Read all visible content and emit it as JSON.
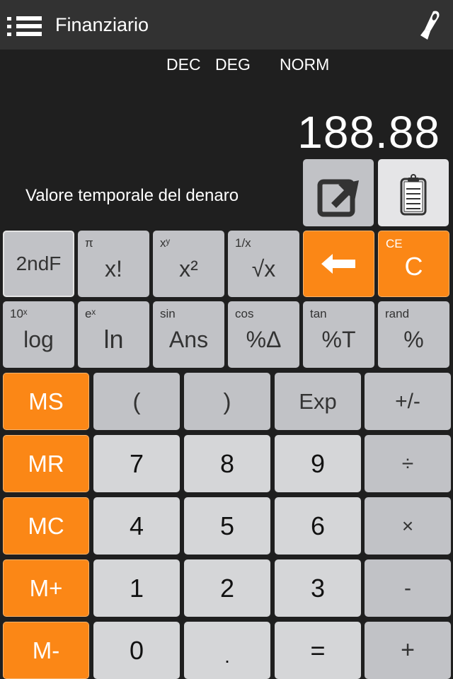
{
  "header": {
    "title": "Finanziario",
    "menu_icon": "menu-list-icon",
    "tape_icon": "paper-tape-icon"
  },
  "status": {
    "base": "DEC",
    "angle": "DEG",
    "notation": "NORM"
  },
  "display": {
    "value": "188.88",
    "mode_label": "Valore temporale del denaro"
  },
  "actions": {
    "export_icon": "share-export-icon",
    "clipboard_icon": "clipboard-icon"
  },
  "colors": {
    "accent": "#fb8716",
    "function_key": "#c1c2c6",
    "number_key": "#d5d6d8",
    "background": "#1f1f1f",
    "topbar": "#323232"
  },
  "sci_keys": {
    "row1": [
      {
        "main": "2ndF",
        "sup": ""
      },
      {
        "main": "x!",
        "sup": "π"
      },
      {
        "main": "x²",
        "sup": "xʸ"
      },
      {
        "main": "√x",
        "sup": "1/x"
      },
      {
        "main": "backspace",
        "sup": ""
      },
      {
        "main": "C",
        "sup": "CE"
      }
    ],
    "row2": [
      {
        "main": "log",
        "sup": "10ˣ"
      },
      {
        "main": "ln",
        "sup": "eˣ"
      },
      {
        "main": "Ans",
        "sup": "sin"
      },
      {
        "main": "%Δ",
        "sup": "cos"
      },
      {
        "main": "%T",
        "sup": "tan"
      },
      {
        "main": "%",
        "sup": "rand"
      }
    ]
  },
  "keys": {
    "memory": [
      "MS",
      "MR",
      "MC",
      "M+",
      "M-"
    ],
    "row1": [
      "(",
      ")",
      "Exp",
      "+/-"
    ],
    "row2": [
      "7",
      "8",
      "9",
      "÷"
    ],
    "row3": [
      "4",
      "5",
      "6",
      "×"
    ],
    "row4": [
      "1",
      "2",
      "3",
      "-"
    ],
    "row5": [
      "0",
      ".",
      "=",
      "+"
    ]
  }
}
